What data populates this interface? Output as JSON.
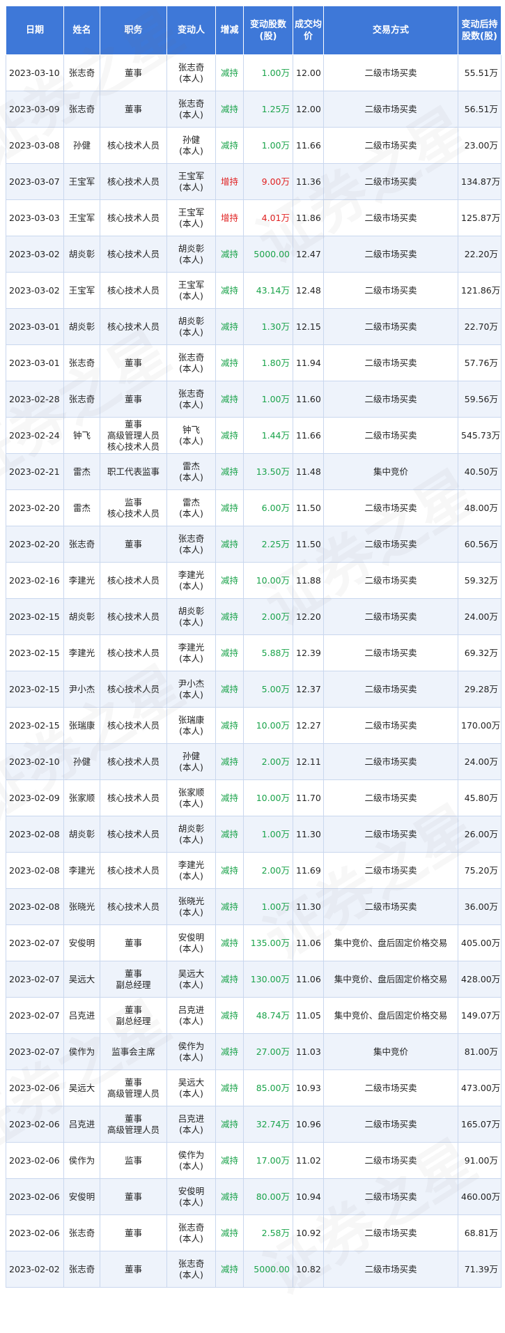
{
  "headers": [
    "日期",
    "姓名",
    "职务",
    "变动人",
    "增减",
    "变动股数(股)",
    "成交均价",
    "交易方式",
    "变动后持股数(股)"
  ],
  "rows": [
    [
      "2023-03-10",
      "张志奇",
      "董事",
      "张志奇(本人)",
      "减持",
      "1.00万",
      "12.00",
      "二级市场买卖",
      "55.51万"
    ],
    [
      "2023-03-09",
      "张志奇",
      "董事",
      "张志奇(本人)",
      "减持",
      "1.25万",
      "12.00",
      "二级市场买卖",
      "56.51万"
    ],
    [
      "2023-03-08",
      "孙健",
      "核心技术人员",
      "孙健(本人)",
      "减持",
      "1.00万",
      "11.66",
      "二级市场买卖",
      "23.00万"
    ],
    [
      "2023-03-07",
      "王宝军",
      "核心技术人员",
      "王宝军(本人)",
      "增持",
      "9.00万",
      "11.36",
      "二级市场买卖",
      "134.87万"
    ],
    [
      "2023-03-03",
      "王宝军",
      "核心技术人员",
      "王宝军(本人)",
      "增持",
      "4.01万",
      "11.86",
      "二级市场买卖",
      "125.87万"
    ],
    [
      "2023-03-02",
      "胡炎彰",
      "核心技术人员",
      "胡炎彰(本人)",
      "减持",
      "5000.00",
      "12.47",
      "二级市场买卖",
      "22.20万"
    ],
    [
      "2023-03-02",
      "王宝军",
      "核心技术人员",
      "王宝军(本人)",
      "减持",
      "43.14万",
      "12.48",
      "二级市场买卖",
      "121.86万"
    ],
    [
      "2023-03-01",
      "胡炎彰",
      "核心技术人员",
      "胡炎彰(本人)",
      "减持",
      "1.30万",
      "12.15",
      "二级市场买卖",
      "22.70万"
    ],
    [
      "2023-03-01",
      "张志奇",
      "董事",
      "张志奇(本人)",
      "减持",
      "1.80万",
      "11.94",
      "二级市场买卖",
      "57.76万"
    ],
    [
      "2023-02-28",
      "张志奇",
      "董事",
      "张志奇(本人)",
      "减持",
      "1.00万",
      "11.60",
      "二级市场买卖",
      "59.56万"
    ],
    [
      "2023-02-24",
      "钟飞",
      "董事\n高级管理人员\n核心技术人员",
      "钟飞(本人)",
      "减持",
      "1.44万",
      "11.66",
      "二级市场买卖",
      "545.73万"
    ],
    [
      "2023-02-21",
      "雷杰",
      "职工代表监事",
      "雷杰(本人)",
      "减持",
      "13.50万",
      "11.48",
      "集中竞价",
      "40.50万"
    ],
    [
      "2023-02-20",
      "雷杰",
      "监事\n核心技术人员",
      "雷杰(本人)",
      "减持",
      "6.00万",
      "11.50",
      "二级市场买卖",
      "48.00万"
    ],
    [
      "2023-02-20",
      "张志奇",
      "董事",
      "张志奇(本人)",
      "减持",
      "2.25万",
      "11.50",
      "二级市场买卖",
      "60.56万"
    ],
    [
      "2023-02-16",
      "李建光",
      "核心技术人员",
      "李建光(本人)",
      "减持",
      "10.00万",
      "11.88",
      "二级市场买卖",
      "59.32万"
    ],
    [
      "2023-02-15",
      "胡炎彰",
      "核心技术人员",
      "胡炎彰(本人)",
      "减持",
      "2.00万",
      "12.20",
      "二级市场买卖",
      "24.00万"
    ],
    [
      "2023-02-15",
      "李建光",
      "核心技术人员",
      "李建光(本人)",
      "减持",
      "5.88万",
      "12.39",
      "二级市场买卖",
      "69.32万"
    ],
    [
      "2023-02-15",
      "尹小杰",
      "核心技术人员",
      "尹小杰(本人)",
      "减持",
      "5.00万",
      "12.37",
      "二级市场买卖",
      "29.28万"
    ],
    [
      "2023-02-15",
      "张瑞康",
      "核心技术人员",
      "张瑞康(本人)",
      "减持",
      "10.00万",
      "12.27",
      "二级市场买卖",
      "170.00万"
    ],
    [
      "2023-02-10",
      "孙健",
      "核心技术人员",
      "孙健(本人)",
      "减持",
      "2.00万",
      "12.11",
      "二级市场买卖",
      "24.00万"
    ],
    [
      "2023-02-09",
      "张家顺",
      "核心技术人员",
      "张家顺(本人)",
      "减持",
      "10.00万",
      "11.70",
      "二级市场买卖",
      "45.80万"
    ],
    [
      "2023-02-08",
      "胡炎彰",
      "核心技术人员",
      "胡炎彰(本人)",
      "减持",
      "1.00万",
      "11.30",
      "二级市场买卖",
      "26.00万"
    ],
    [
      "2023-02-08",
      "李建光",
      "核心技术人员",
      "李建光(本人)",
      "减持",
      "2.00万",
      "11.69",
      "二级市场买卖",
      "75.20万"
    ],
    [
      "2023-02-08",
      "张晓光",
      "核心技术人员",
      "张晓光(本人)",
      "减持",
      "1.00万",
      "11.30",
      "二级市场买卖",
      "36.00万"
    ],
    [
      "2023-02-07",
      "安俊明",
      "董事",
      "安俊明(本人)",
      "减持",
      "135.00万",
      "11.06",
      "集中竞价、盘后固定价格交易",
      "405.00万"
    ],
    [
      "2023-02-07",
      "吴远大",
      "董事\n副总经理",
      "吴远大(本人)",
      "减持",
      "130.00万",
      "11.06",
      "集中竞价、盘后固定价格交易",
      "428.00万"
    ],
    [
      "2023-02-07",
      "吕克进",
      "董事\n副总经理",
      "吕克进(本人)",
      "减持",
      "48.74万",
      "11.05",
      "集中竞价、盘后固定价格交易",
      "149.07万"
    ],
    [
      "2023-02-07",
      "侯作为",
      "监事会主席",
      "侯作为(本人)",
      "减持",
      "27.00万",
      "11.03",
      "集中竞价",
      "81.00万"
    ],
    [
      "2023-02-06",
      "吴远大",
      "董事\n高级管理人员",
      "吴远大(本人)",
      "减持",
      "85.00万",
      "10.93",
      "二级市场买卖",
      "473.00万"
    ],
    [
      "2023-02-06",
      "吕克进",
      "董事\n高级管理人员",
      "吕克进(本人)",
      "减持",
      "32.74万",
      "10.96",
      "二级市场买卖",
      "165.07万"
    ],
    [
      "2023-02-06",
      "侯作为",
      "监事",
      "侯作为(本人)",
      "减持",
      "17.00万",
      "11.02",
      "二级市场买卖",
      "91.00万"
    ],
    [
      "2023-02-06",
      "安俊明",
      "董事",
      "安俊明(本人)",
      "减持",
      "80.00万",
      "10.94",
      "二级市场买卖",
      "460.00万"
    ],
    [
      "2023-02-06",
      "张志奇",
      "董事",
      "张志奇(本人)",
      "减持",
      "2.58万",
      "10.92",
      "二级市场买卖",
      "68.81万"
    ],
    [
      "2023-02-02",
      "张志奇",
      "董事",
      "张志奇(本人)",
      "减持",
      "5000.00",
      "10.82",
      "二级市场买卖",
      "71.39万"
    ]
  ],
  "watermark": "证券之星",
  "colors": {
    "header_bg": "#3e78d8",
    "decrease": "#1aa34a",
    "increase": "#e02020"
  }
}
